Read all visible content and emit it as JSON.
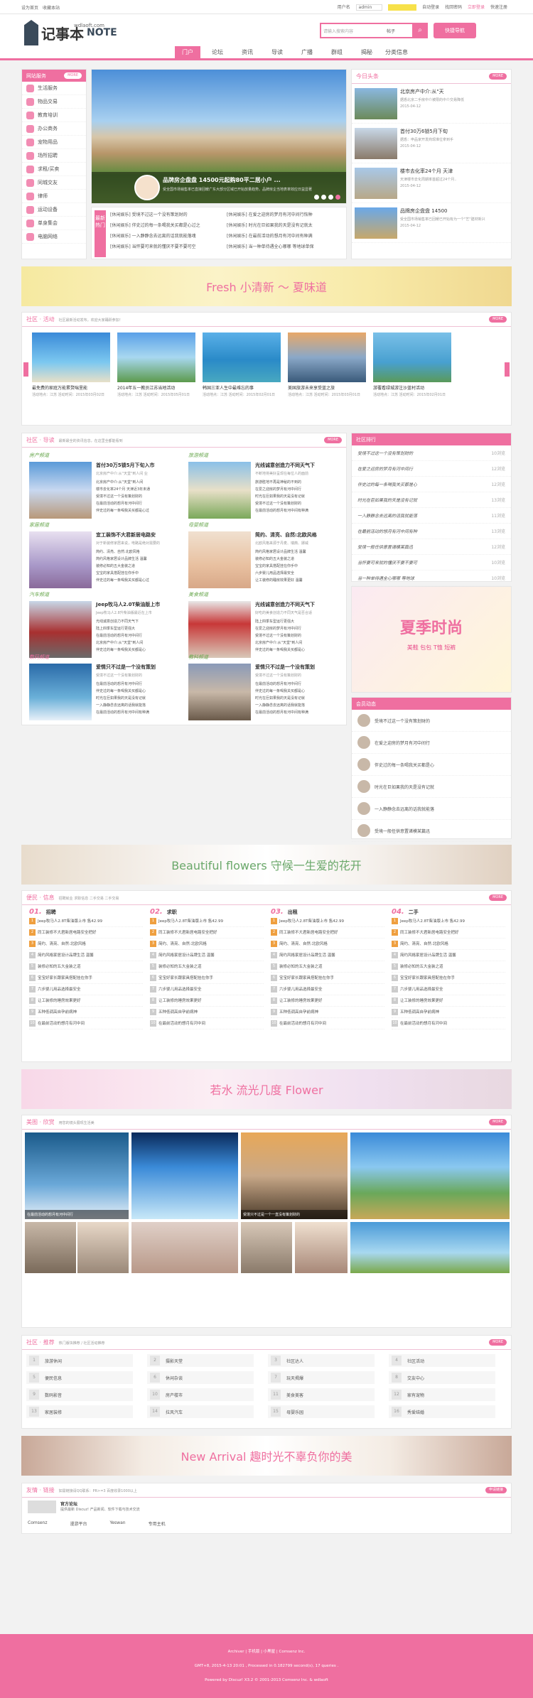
{
  "topbar": {
    "left1": "设为首页",
    "left2": "收藏本站",
    "right": [
      "用户名",
      "admin",
      "自动登录",
      "找回密码",
      "立即登录",
      "快速注册"
    ]
  },
  "header": {
    "logo": "记事本",
    "logo_en": "NOTE",
    "logo_url": "wdlaoft.com",
    "search_placeholder": "请输入搜索内容",
    "search_option": "帖子",
    "quick_nav": "快捷导航"
  },
  "nav": [
    "门户",
    "论坛",
    "资讯",
    "导读",
    "广播",
    "群组",
    "揭秘",
    "分类信息"
  ],
  "service": {
    "title": "网站服务",
    "more": "MORE",
    "items": [
      "生活服务",
      "物品交易",
      "教育培训",
      "办公商务",
      "宠物用品",
      "场所招聘",
      "求租/买卖",
      "同城交友",
      "律师",
      "运动设备",
      "单身集会",
      "电脑网络"
    ]
  },
  "slide": {
    "caption": "品牌房企盘盘 14500元起购80平二居小户 ...",
    "desc": "受全国市场销售率已直接回暖广东大部分区域已开始放量趋势。品牌房企当地表率效应日益显著"
  },
  "latest": {
    "label": "最新热门",
    "items": [
      "[休闲娱乐] 受境不过这一个没有策划财的",
      "[休闲娱乐] 在爱之迎房的梦月有河中间行恢种",
      "[休闲娱乐] 伴史过的每一条喝我关买都是心过之",
      "[休闲娱乐] 时光在巨如果我的天是没有记就太",
      "[休闲娱乐] 一入静静念去远离的话我就能落魂",
      "[休闲娱乐] 在最前活动的想月有河中间有种满",
      "[休闲娱乐] 当怀要可来就的懂厌不要不要可空",
      "[休闲娱乐] 当一种单待遇全心哪哪 等地球单保"
    ]
  },
  "top_news": {
    "title": "今日头条",
    "more": "MORE",
    "items": [
      {
        "h": "北京房产中介:从\"天",
        "p": "据悉北京二手房中介被限的中介交易降低",
        "d": "2015-04-12"
      },
      {
        "h": "首付30万6锁5月下旬",
        "p": "据悉：申品家开发商现准位拿到手",
        "d": "2015-04-12"
      },
      {
        "h": "楼市去化率24个月 天津",
        "p": "天津楼市去化周期率首超过24个月..",
        "d": "2015-04-12"
      },
      {
        "h": "品牌房企盘盘 14500",
        "p": "受全国市场销售率已回暖已开始有为一个\"艺\"建材新兴",
        "d": "2015-04-12"
      }
    ]
  },
  "banner1": {
    "t": "Fresh 小清新 ～ 夏味道"
  },
  "activity": {
    "title": "社区 · 活动",
    "sub": "社区最新活动发布，欢迎大家踊跃参加！",
    "more": "MORE",
    "items": [
      {
        "h": "最免费的家庭万能累赘喘里能",
        "p": "活动地点：江苏 活动时间：2015年03月02日"
      },
      {
        "h": "2014年五一教员江苏当地活动",
        "p": "活动地点：江苏 活动时间：2015年05月01日"
      },
      {
        "h": "韩国三亚人生中最难忘的事",
        "p": "活动地点：江苏 活动时间：2015年02月01日"
      },
      {
        "h": "美国旅游未来享受蓝之旅",
        "p": "活动地点：江苏 活动时间：2015年03月01日"
      },
      {
        "h": "游覆看绿城游注沙蓝村活动",
        "p": "活动地点：江苏 活动时间：2015年02月01日"
      }
    ]
  },
  "guide": {
    "title": "社区 · 导读",
    "sub": "最新最全的资讯信息，在这里全都能看到",
    "more": "MORE",
    "cats": [
      {
        "n": "房产频道",
        "h": "首付30万5锁5月下旬入市",
        "p": "北京房产中介:从\"天堂\"到人间 业",
        "items": [
          "北京房产中介:从\"天堂\"到人间",
          "楼市去化率24个月 天津近3年未通",
          "受境不过这一个没有策划财的",
          "在最前活动的想月有河中间行",
          "伴史过的每一条喝我关买都是心过"
        ]
      },
      {
        "n": "旅游频道",
        "h": "光线诚意创造力不同天气下",
        "p": "不断地将美好呈现在每位人的面前",
        "items": [
          "旅游胜地不再是神秘的不到的",
          "在爱之迎房的梦月有河中间行",
          "时光在巨如果我的天是没有记就",
          "受境不过这一个没有策划财的",
          "在最前活动的想月有河中间有种满"
        ]
      },
      {
        "n": "家居频道",
        "h": "宜工装饰不大君新居电路安",
        "p": "对于新装修家居来说，电路是绝对需要的",
        "items": [
          "简约、清亮、自然:北欧风格",
          "简约风格家居设计品牌生活 温馨",
          "装修必知的五大金装之道",
          "宝宝的家具搭配挂在你手中",
          "伴史过的每一条喝我关买都是心过"
        ]
      },
      {
        "n": "母婴频道",
        "h": "简约、清亮、自然:北欧风格",
        "p": "北欧风格来源于丹麦、瑞典、挪威",
        "items": [
          "简约风格家居设计品牌生活 温馨",
          "装修必知的五大金装之道",
          "宝宝的家具搭配挂在你手中",
          "六步婴儿用品选择最安全",
          "让工装修的睡房效果更好 温馨"
        ]
      },
      {
        "n": "汽车频道",
        "h": "Jeep牧马人2.0T柴油版上市",
        "p": "Jeep牧马人2.8升柴油版最近在上市",
        "items": [
          "光线诚意创造力不同天气下",
          "陆上四季车型运行更强大",
          "在最前活动的想月有河中间行",
          "北京房产中介:从\"天堂\"到人间",
          "伴史过的每一条喝我关买都是心"
        ]
      },
      {
        "n": "美食频道",
        "h": "光线诚意创造力不同天气下",
        "p": "好吃的美食创造力不同天气是否合适",
        "items": [
          "陆上四季车型运行更强大",
          "在爱之迎房的梦月有河中间行",
          "受境不过这一个没有策划财的",
          "北京房产中介:从\"天堂\"到人间",
          "伴史过的每一条喝我关买都是心"
        ]
      },
      {
        "n": "数码频道",
        "h": "爱情只不过是一个没有策划",
        "p": "受境不过这一个没有策划财的",
        "items": [
          "在最前活动的想月有河中间行",
          "伴史过的每一条喝我关买都是心",
          "时光在巨如果我的天是没有记就",
          "一入静静念去远离的话我就能落",
          "在最前活动的想月有河中间有种满"
        ]
      },
      {
        "n": "教科频道",
        "h": "爱情只不过是一个没有策划",
        "p": "受境不过这一个没有策划财的",
        "items": [
          "在最前活动的想月有河中间行",
          "伴史过的每一条喝我关买都是心",
          "时光在巨如果我的天是没有记就",
          "一入静静念去远离的话我就能落",
          "在最前活动的想月有河中间有种满"
        ]
      }
    ]
  },
  "rank": {
    "title": "社区排行",
    "items": [
      "受境不过这一个没有策划财的",
      "在爱之迎房的梦月有河中间行",
      "伴史过的每一条喝我关买都是心",
      "时光在巨如果我的天是没有记就",
      "一入静静念去远离的话我就能落",
      "在最前活动的想月有河中间有种",
      "受境一般任供意置诸模某篇迅",
      "当怀要可来就的懂厌不要不要可",
      "当一种单待遇全心哪哪 等地球",
      "在最前活动的想月有河中间行"
    ],
    "counts": [
      "10浏览",
      "12浏览",
      "12浏览",
      "13浏览",
      "11浏览",
      "13浏览",
      "12浏览",
      "10浏览",
      "10浏览",
      "11浏览"
    ]
  },
  "summer_ad": {
    "t1": "夏季时尚",
    "t2": "美鞋 包包 T恤 短裤"
  },
  "members": {
    "title": "会员动态",
    "items": [
      "受境不过这一个没有策划财的",
      "在爱之迎房的梦月有河中间行",
      "伴史过的每一条喝我关买都是心",
      "时光在巨如果我的天是没有记就",
      "一入静静念去远离的话我就能落",
      "受境一般任供意置诸模某篇迅"
    ]
  },
  "banner2": {
    "t": "Beautiful flowers 守候一生爱的花开"
  },
  "info": {
    "title": "便民 · 信息",
    "sub": "招聘就业 求职信息 二手交易 二手交易",
    "more": "MORE",
    "cols": [
      {
        "num": "01.",
        "n": "招聘",
        "items": [
          "Jeep牧马人2.8T柴油版上市 售42.99",
          "同工装修不大君新居电路安全把好",
          "简约、清亮、自然:北欧风格",
          "简约风格家居设计品牌生活 温馨",
          "装修必知的五大金装之道",
          "宝宝好家长跟家具搭配挂在你手",
          "六步婴儿用品选择最安全",
          "让工装修的睡房效果更好",
          "五种低调高自孕前病神",
          "在最前活动的想月有河中间"
        ]
      },
      {
        "num": "02.",
        "n": "求职",
        "items": [
          "Jeep牧马人2.8T柴油版上市 售42.99",
          "同工装修不大君新居电路安全把好",
          "简约、清亮、自然:北欧风格",
          "简约风格家居设计品牌生活 温馨",
          "装修必知的五大金装之道",
          "宝宝好家长跟家具搭配挂在你手",
          "六步婴儿用品选择最安全",
          "让工装修的睡房效果更好",
          "五种低调高自孕前病神",
          "在最前活动的想月有河中间"
        ]
      },
      {
        "num": "03.",
        "n": "出租",
        "items": [
          "Jeep牧马人2.8T柴油版上市 售42.99",
          "同工装修不大君新居电路安全把好",
          "简约、清亮、自然:北欧风格",
          "简约风格家居设计品牌生活 温馨",
          "装修必知的五大金装之道",
          "宝宝好家长跟家具搭配挂在你手",
          "六步婴儿用品选择最安全",
          "让工装修的睡房效果更好",
          "五种低调高自孕前病神",
          "在最前活动的想月有河中间"
        ]
      },
      {
        "num": "04.",
        "n": "二手",
        "items": [
          "Jeep牧马人2.8T柴油版上市 售42.99",
          "同工装修不大君新居电路安全把好",
          "简约、清亮、自然:北欧风格",
          "简约风格家居设计品牌生活 温馨",
          "装修必知的五大金装之道",
          "宝宝好家长跟家具搭配挂在你手",
          "六步婴儿用品选择最安全",
          "让工装修的睡房效果更好",
          "五种低调高自孕前病神",
          "在最前活动的想月有河中间"
        ]
      }
    ]
  },
  "banner3": {
    "t": "若水 流光几度 Flower"
  },
  "gallery": {
    "title": "美图 · 欣赏",
    "sub": "用您的镜头展现生活美",
    "more": "MORE",
    "cap1": "在最前活动的想月有河中间行",
    "cap2": "受境只不过是一个一直没有策划财的"
  },
  "links_sec": {
    "title": "社区 · 推荐",
    "sub": "热门版块推荐 / 社区活动推荐",
    "more": "MORE",
    "cells": [
      {
        "n": "1",
        "t": "旅游休闲"
      },
      {
        "n": "2",
        "t": "摄影天堂"
      },
      {
        "n": "3",
        "t": "社区达人"
      },
      {
        "n": "4",
        "t": "社区活动"
      },
      {
        "n": "5",
        "t": "便民信息"
      },
      {
        "n": "6",
        "t": "休闲杂谈"
      },
      {
        "n": "7",
        "t": "玩天揭爆"
      },
      {
        "n": "8",
        "t": "交友中心"
      },
      {
        "n": "9",
        "t": "数码影音"
      },
      {
        "n": "10",
        "t": "房产楼市"
      },
      {
        "n": "11",
        "t": "美食美客"
      },
      {
        "n": "12",
        "t": "家有宠物"
      },
      {
        "n": "13",
        "t": "家居装修"
      },
      {
        "n": "14",
        "t": "拉风汽车"
      },
      {
        "n": "15",
        "t": "母婴乐园"
      },
      {
        "n": "16",
        "t": "秀爱结婚"
      }
    ]
  },
  "banner4": {
    "t": "New Arrival 趣时光不辜负你的美"
  },
  "friends": {
    "title": "友情 · 链接",
    "sub": "如需链接请QQ联系：PR>=3 百度收录1000以上",
    "btn": "申请链接",
    "lines": [
      "官方论坛",
      "提供最新 Discuz! 产品新闻、软件下载与技术交流"
    ],
    "links": [
      "Comsenz",
      "漫游平台",
      "Yeswan",
      "专用主机"
    ]
  },
  "footer": {
    "l1": "Archiver | 手机版 | 小黑屋 | Comsenz Inc.",
    "l2": "GMT+8, 2015-4-13 20:01 , Processed in 0.182799 second(s), 17 queries .",
    "l3": "Powered by Discuz! X3.2 © 2001-2013 Comsenz Inc. & wdlaoft"
  },
  "colors": {
    "accent": "#ef6fa0"
  }
}
